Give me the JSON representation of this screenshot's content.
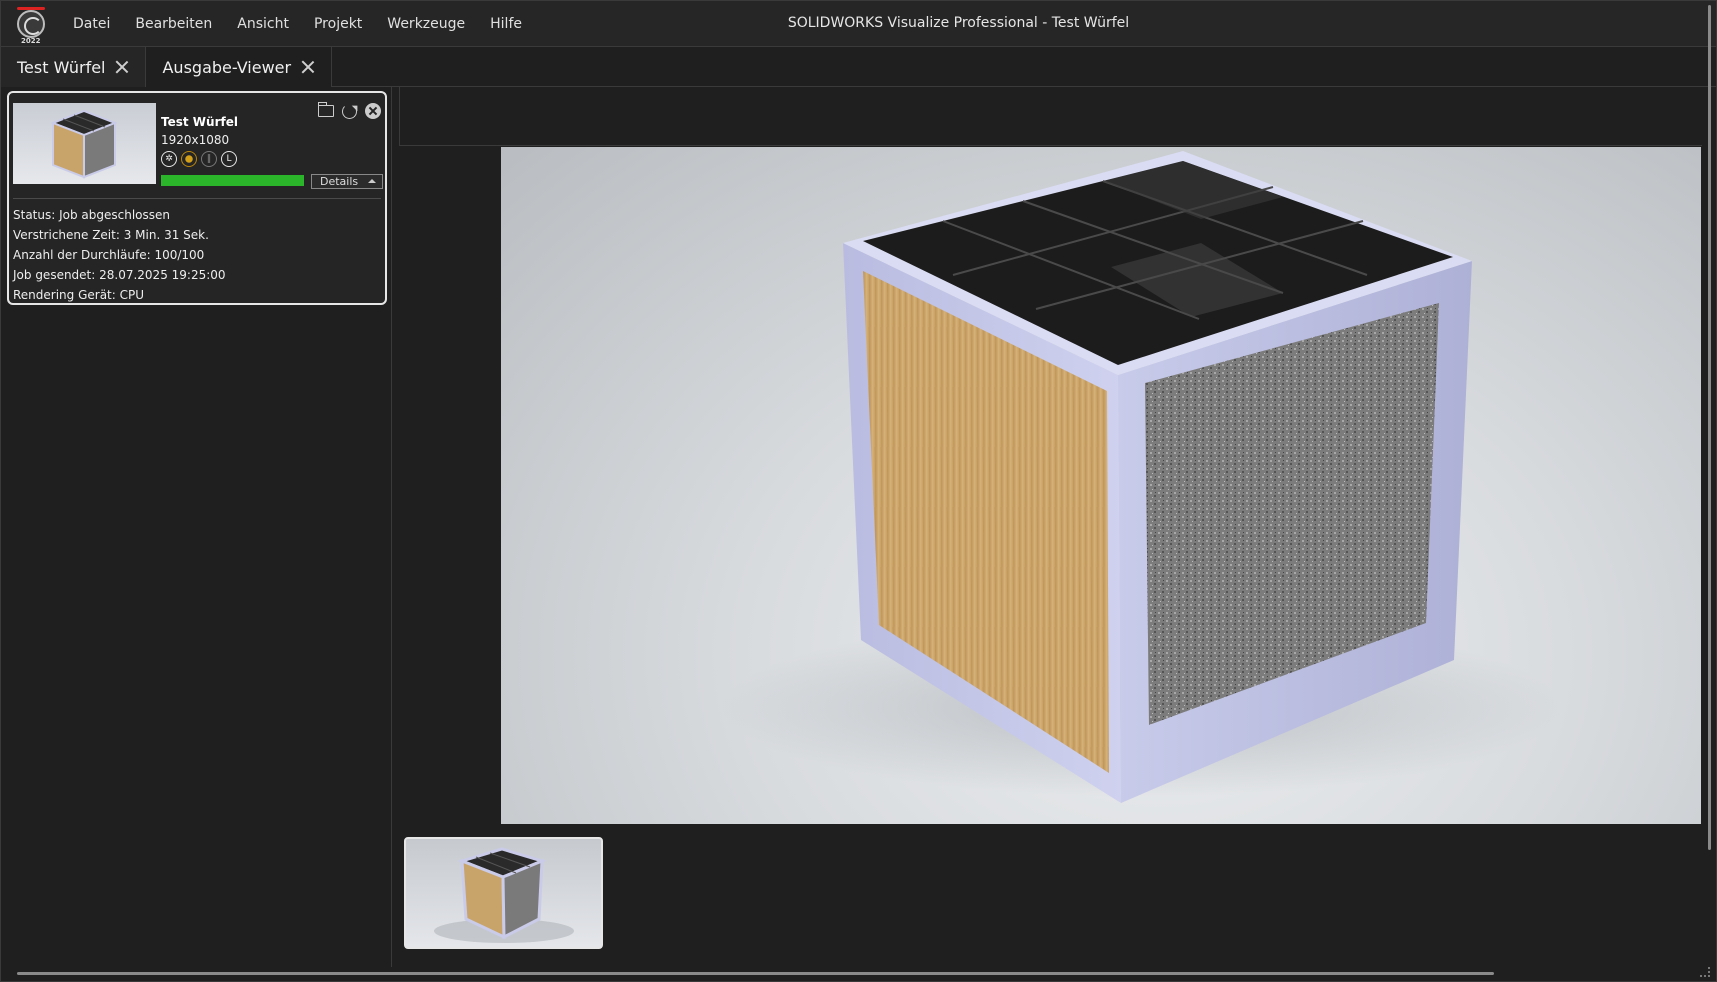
{
  "menubar": {
    "logo_year": "2022",
    "items": [
      "Datei",
      "Bearbeiten",
      "Ansicht",
      "Projekt",
      "Werkzeuge",
      "Hilfe"
    ],
    "window_title": "SOLIDWORKS Visualize Professional - Test Würfel"
  },
  "tabs": [
    {
      "label": "Test Würfel",
      "active": true
    },
    {
      "label": "Ausgabe-Viewer",
      "active": false
    }
  ],
  "job": {
    "name": "Test Würfel",
    "resolution": "1920x1080",
    "progress": 1.0,
    "details_label": "Details",
    "icons": [
      "aperture-icon",
      "sun-icon",
      "pause-icon",
      "lock-icon"
    ],
    "info": [
      "Status: Job abgeschlossen",
      "Verstrichene Zeit: 3 Min. 31 Sek.",
      "Anzahl der Durchläufe: 100/100",
      "Job gesendet: 28.07.2025 19:25:00",
      "Rendering Gerät: CPU"
    ]
  },
  "colors": {
    "progress": "#2bb52b",
    "frame": "#c9cbe8",
    "wood": "#c9a46a",
    "granite": "#7a7a7a",
    "tile": "#2a2a2a"
  }
}
